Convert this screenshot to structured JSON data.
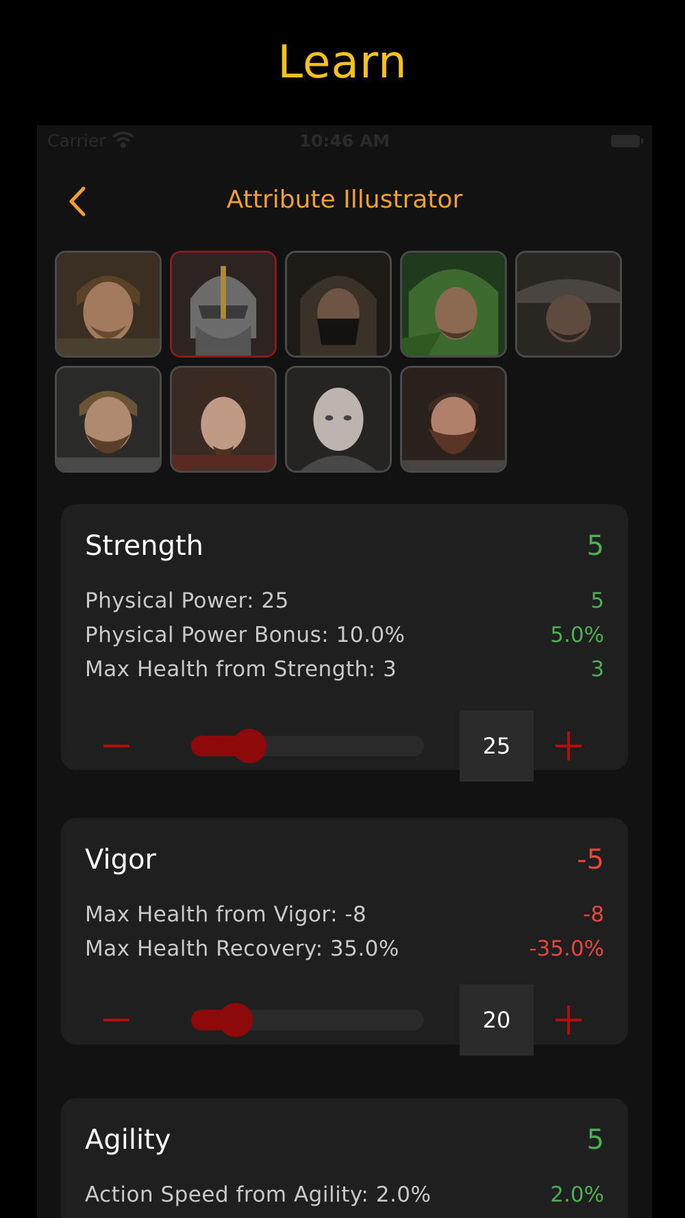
{
  "page_title": "Learn",
  "status_bar": {
    "carrier": "Carrier",
    "time": "10:46 AM",
    "wifi_icon": "wifi-icon",
    "battery_icon": "battery-icon"
  },
  "nav": {
    "title": "Attribute Illustrator",
    "back_icon": "chevron-left-icon"
  },
  "colors": {
    "accent": "#f0a030",
    "title": "#f6c21a",
    "positive": "#4caf50",
    "negative": "#e5453d",
    "control": "#8e0a0a"
  },
  "characters": [
    {
      "name": "character-1",
      "selected": false
    },
    {
      "name": "character-2",
      "selected": true
    },
    {
      "name": "character-3",
      "selected": false
    },
    {
      "name": "character-4",
      "selected": false
    },
    {
      "name": "character-5",
      "selected": false
    },
    {
      "name": "character-6",
      "selected": false
    },
    {
      "name": "character-7",
      "selected": false
    },
    {
      "name": "character-8",
      "selected": false
    },
    {
      "name": "character-9",
      "selected": false
    }
  ],
  "attributes": {
    "strength": {
      "title": "Strength",
      "total": "5",
      "stats": [
        {
          "label": "Physical Power: 25",
          "delta": "5"
        },
        {
          "label": "Physical Power Bonus: 10.0%",
          "delta": "5.0%"
        },
        {
          "label": "Max Health from Strength: 3",
          "delta": "3"
        }
      ],
      "value": "25",
      "slider_fraction": 0.25
    },
    "vigor": {
      "title": "Vigor",
      "total": "-5",
      "stats": [
        {
          "label": "Max Health from Vigor: -8",
          "delta": "-8"
        },
        {
          "label": "Max Health Recovery: 35.0%",
          "delta": "-35.0%"
        }
      ],
      "value": "20",
      "slider_fraction": 0.19
    },
    "agility": {
      "title": "Agility",
      "total": "5",
      "stats": [
        {
          "label": "Action Speed from Agility: 2.0%",
          "delta": "2.0%"
        }
      ]
    }
  }
}
